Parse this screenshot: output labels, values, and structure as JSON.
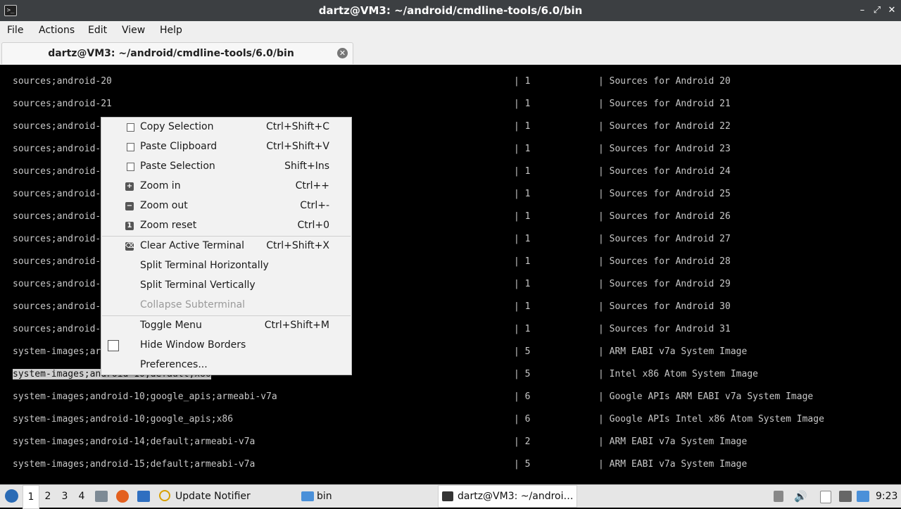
{
  "window": {
    "title": "dartz@VM3: ~/android/cmdline-tools/6.0/bin",
    "controls": [
      "–",
      "⤢",
      "✕"
    ]
  },
  "menubar": [
    "File",
    "Actions",
    "Edit",
    "View",
    "Help"
  ],
  "tab": {
    "label": "dartz@VM3: ~/android/cmdline-tools/6.0/bin",
    "close": "✕"
  },
  "terminal_rows": [
    {
      "c1": "sources;android-20",
      "c2": "| 1",
      "c3": "| Sources for Android 20"
    },
    {
      "c1": "sources;android-21",
      "c2": "| 1",
      "c3": "| Sources for Android 21"
    },
    {
      "c1": "sources;android-",
      "c2": "| 1",
      "c3": "| Sources for Android 22"
    },
    {
      "c1": "sources;android-",
      "c2": "| 1",
      "c3": "| Sources for Android 23"
    },
    {
      "c1": "sources;android-",
      "c2": "| 1",
      "c3": "| Sources for Android 24"
    },
    {
      "c1": "sources;android-",
      "c2": "| 1",
      "c3": "| Sources for Android 25"
    },
    {
      "c1": "sources;android-",
      "c2": "| 1",
      "c3": "| Sources for Android 26"
    },
    {
      "c1": "sources;android-",
      "c2": "| 1",
      "c3": "| Sources for Android 27"
    },
    {
      "c1": "sources;android-",
      "c2": "| 1",
      "c3": "| Sources for Android 28"
    },
    {
      "c1": "sources;android-",
      "c2": "| 1",
      "c3": "| Sources for Android 29"
    },
    {
      "c1": "sources;android-",
      "c2": "| 1",
      "c3": "| Sources for Android 30"
    },
    {
      "c1": "sources;android-",
      "c2": "| 1",
      "c3": "| Sources for Android 31"
    },
    {
      "c1": "system-images;ar",
      "c2": "| 5",
      "c3": "| ARM EABI v7a System Image"
    },
    {
      "c1": "system-images;android-10;default;x86",
      "c2": "| 5",
      "c3": "| Intel x86 Atom System Image",
      "selected": true
    },
    {
      "c1": "system-images;android-10;google_apis;armeabi-v7a",
      "c2": "| 6",
      "c3": "| Google APIs ARM EABI v7a System Image"
    },
    {
      "c1": "system-images;android-10;google_apis;x86",
      "c2": "| 6",
      "c3": "| Google APIs Intel x86 Atom System Image"
    },
    {
      "c1": "system-images;android-14;default;armeabi-v7a",
      "c2": "| 2",
      "c3": "| ARM EABI v7a System Image"
    },
    {
      "c1": "system-images;android-15;default;armeabi-v7a",
      "c2": "| 5",
      "c3": "| ARM EABI v7a System Image"
    }
  ],
  "context_menu": {
    "items": [
      {
        "label": "Copy Selection",
        "shortcut": "Ctrl+Shift+C",
        "icon": "copy-icon"
      },
      {
        "label": "Paste Clipboard",
        "shortcut": "Ctrl+Shift+V",
        "icon": "paste-icon"
      },
      {
        "label": "Paste Selection",
        "shortcut": "Shift+Ins",
        "icon": "paste-icon"
      },
      {
        "label": "Zoom in",
        "shortcut": "Ctrl++",
        "icon": "zoom-in-icon"
      },
      {
        "label": "Zoom out",
        "shortcut": "Ctrl+-",
        "icon": "zoom-out-icon"
      },
      {
        "label": "Zoom reset",
        "shortcut": "Ctrl+0",
        "icon": "zoom-reset-icon"
      },
      {
        "label": "Clear Active Terminal",
        "shortcut": "Ctrl+Shift+X",
        "icon": "clear-icon"
      },
      {
        "label": "Split Terminal Horizontally",
        "shortcut": ""
      },
      {
        "label": "Split Terminal Vertically",
        "shortcut": ""
      },
      {
        "label": "Collapse Subterminal",
        "shortcut": "",
        "disabled": true
      },
      {
        "label": "Toggle Menu",
        "shortcut": "Ctrl+Shift+M"
      },
      {
        "label": "Hide Window Borders",
        "shortcut": "",
        "checkbox": false
      },
      {
        "label": "Preferences...",
        "shortcut": ""
      }
    ]
  },
  "taskbar": {
    "workspaces": [
      "1",
      "2",
      "3",
      "4"
    ],
    "active_workspace": "1",
    "update_notifier": "Update Notifier",
    "folder": "bin",
    "terminal_task": "dartz@VM3: ~/androi…",
    "clock": "9:23"
  }
}
